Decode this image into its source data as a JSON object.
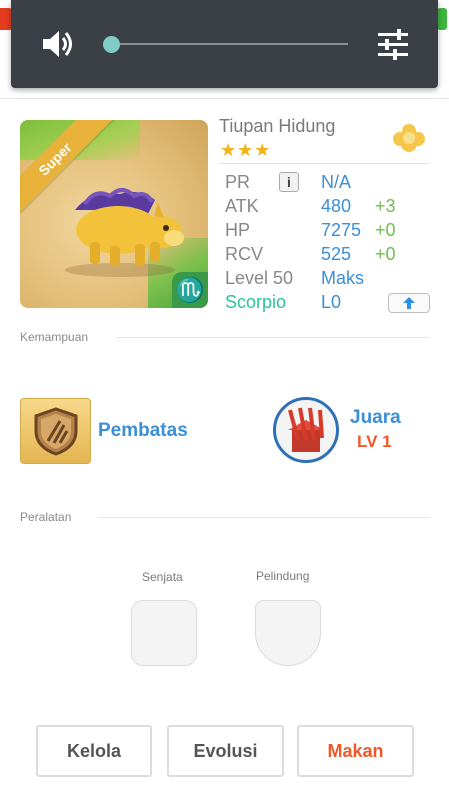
{
  "monster": {
    "name": "Tiupan Hidung",
    "rarity_label": "Super",
    "stars": "★★★",
    "zodiac_symbol": "♏"
  },
  "stats": {
    "pr_label": "PR",
    "pr_value": "N/A",
    "info_glyph": "i",
    "atk_label": "ATK",
    "atk_value": "480",
    "atk_bonus": "+3",
    "hp_label": "HP",
    "hp_value": "7275",
    "hp_bonus": "+0",
    "rcv_label": "RCV",
    "rcv_value": "525",
    "rcv_bonus": "+0",
    "level_label": "Level 50",
    "level_value": "Maks",
    "zodiac_label": "Scorpio",
    "zodiac_value": "L0"
  },
  "abilities": {
    "section_label": "Kemampuan",
    "skill_name": "Pembatas",
    "leader_name": "Juara",
    "leader_level": "LV 1"
  },
  "equipment": {
    "section_label": "Peralatan",
    "weapon_label": "Senjata",
    "armor_label": "Pelindung"
  },
  "actions": {
    "manage_label": "Kelola",
    "evolve_label": "Evolusi",
    "feed_label": "Makan"
  },
  "colors": {
    "accent_blue": "#3a8fd6",
    "bonus_green": "#6cc04a",
    "zodiac_teal": "#2cc39a",
    "feed_orange": "#f0582a",
    "star_gold": "#f2b21a",
    "volume_panel": "#3a4046",
    "volume_thumb": "#80cbc4"
  },
  "volume": {
    "level": 0.0
  }
}
